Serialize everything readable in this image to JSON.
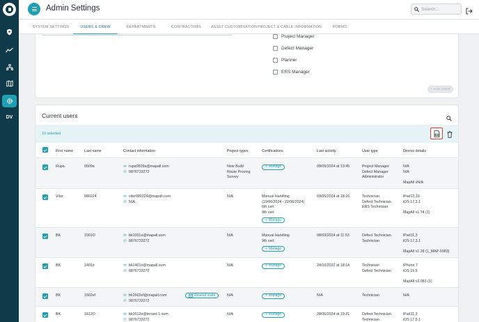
{
  "header": {
    "title": "Admin Settings",
    "search_placeholder": "Search...",
    "sidebar_label": "DV"
  },
  "tabs": [
    {
      "label": "SYSTEM SETTINGS"
    },
    {
      "label": "USERS & CREW"
    },
    {
      "label": "DEPARTMENTS"
    },
    {
      "label": "CONTRACTORS"
    },
    {
      "label": "ASSET CUSTOMISATION"
    },
    {
      "label": "PROJECT & CABLE INFORMATION"
    },
    {
      "label": "FORMS"
    }
  ],
  "roles": [
    {
      "label": "Project Manager"
    },
    {
      "label": "Defect Manager"
    },
    {
      "label": "Planner"
    },
    {
      "label": "ERS Manager"
    }
  ],
  "add_user_label": "+ ADD USER",
  "current_users": {
    "title": "Current users",
    "selected_text": "10 selected",
    "columns": [
      "First name",
      "Last name",
      "Contact information",
      "Project types",
      "Certifications",
      "Last activity",
      "User type",
      "Device details"
    ],
    "manage_label": "Manage",
    "resend_label": "Resend invite",
    "rows": [
      {
        "first": "Rupa",
        "last": "0509a",
        "email": "rupa0509a@mapall.com",
        "phone": "0876733272",
        "project_types": [
          "New Build",
          "Route Proving",
          "Survey"
        ],
        "certs": [],
        "last_activity": "09/09/2024 at 13:45",
        "user_type": [
          "Project Manager",
          "Defect Manager",
          "Administrator"
        ],
        "device": [
          "N/A",
          "N/A",
          "",
          "MapAll vN/A"
        ]
      },
      {
        "first": "Vitor",
        "last": "080224",
        "email": "vitor080224@mapall.com",
        "phone": "N/A",
        "project_types": [
          "N/A"
        ],
        "certs": [
          "Manual Handling",
          "(19/06/2024 - 22/06/2024)",
          "6th cert",
          "9th cert"
        ],
        "last_activity": "03/05/2024 at 18:16",
        "user_type": [
          "Technician",
          "Defect Technician",
          "ERS Technician"
        ],
        "device": [
          "iPad13,19",
          "iOS 17.3.1",
          "",
          "MapAll v1.74 (1)"
        ]
      },
      {
        "first": "BK",
        "last": "1001O",
        "email": "bk1001o@mapall.com",
        "phone": "0876733272",
        "project_types": [
          "N/A"
        ],
        "certs": [
          "Manual Handling",
          "9th cert"
        ],
        "last_activity": "08/03/2024 at 11:53",
        "user_type": [
          "Defect Technician",
          "Technician"
        ],
        "device": [
          "iPad11,3",
          "iOS 17.3.1",
          "",
          "MapAll v1.28 (1_MAP-5983)"
        ]
      },
      {
        "first": "BK",
        "last": "1401o",
        "email": "bk1401o@mapall.com",
        "phone": "0876733272",
        "project_types": [
          "N/A"
        ],
        "certs": [],
        "last_activity": "24/10/2022 at 18:14",
        "user_type": [
          "Technician",
          "Defect Technician"
        ],
        "device": [
          "iPhone 7",
          "iOS 15.5",
          "",
          "MapAll v3.083 (1)"
        ]
      },
      {
        "first": "BK",
        "last": "1602ef",
        "email": "bk1602ef@mapall.com",
        "phone": "0876733272",
        "project_types": [
          "N/A"
        ],
        "certs": [],
        "last_activity": "N/A",
        "user_type": [
          "Technician"
        ],
        "device": [
          "N/A"
        ]
      },
      {
        "first": "BK",
        "last": "1612O",
        "email": "bk1612o@tenant-1.com",
        "phone": "0876733272",
        "project_types": [
          "N/A"
        ],
        "certs": [],
        "last_activity": "28/06/2024 at 19:21",
        "user_type": [
          "Defect Technician",
          "Technician"
        ],
        "device": [
          "iPad11,3",
          "iOS 17.5.1"
        ]
      }
    ]
  },
  "colors": {
    "sidebar": "#0e3a4a",
    "accent": "#1e9fb3",
    "highlight": "#e03b2c"
  }
}
